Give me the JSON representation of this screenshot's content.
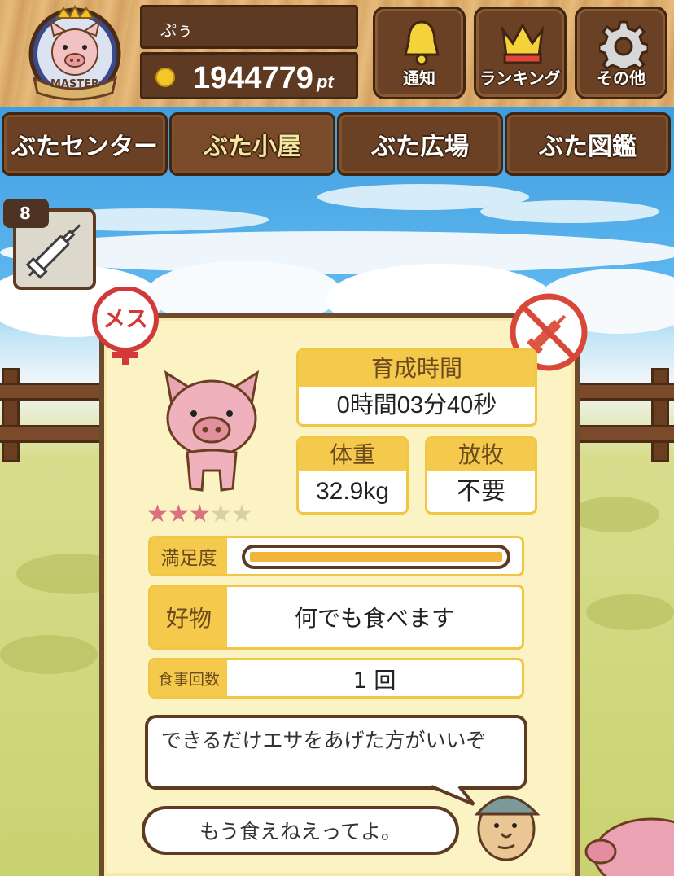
{
  "header": {
    "badge_text": "MASTER",
    "user_name": "ぷぅ",
    "points": "1944779",
    "points_unit": "pt",
    "buttons": [
      {
        "label": "通知",
        "icon": "bell-icon"
      },
      {
        "label": "ランキング",
        "icon": "crown-icon"
      },
      {
        "label": "その他",
        "icon": "gear-icon"
      }
    ]
  },
  "tabs": [
    {
      "label": "ぶたセンター",
      "active": false
    },
    {
      "label": "ぶた小屋",
      "active": true
    },
    {
      "label": "ぶた広場",
      "active": false
    },
    {
      "label": "ぶた図鑑",
      "active": false
    }
  ],
  "item": {
    "count": "8",
    "icon": "syringe-icon"
  },
  "pig_card": {
    "gender_label": "メス",
    "rating": {
      "value": 3,
      "max": 5
    },
    "growth_time": {
      "label": "育成時間",
      "value": "0時間03分40秒"
    },
    "weight": {
      "label": "体重",
      "value": "32.9kg"
    },
    "grazing": {
      "label": "放牧",
      "value": "不要"
    },
    "satisfaction": {
      "label": "満足度",
      "level": 1.0
    },
    "favorite_food": {
      "label": "好物",
      "value": "何でも食べます"
    },
    "meal_count": {
      "label": "食事回数",
      "value": "1 回"
    },
    "advice": "できるだけエサをあげた方がいいぞ",
    "pig_comment": "もう食えねえってよ。"
  },
  "colors": {
    "wood_dark": "#5d3a21",
    "panel_yellow": "#f5ca4c",
    "card_bg": "#fcf3c4",
    "badge_red": "#d23a3a"
  }
}
